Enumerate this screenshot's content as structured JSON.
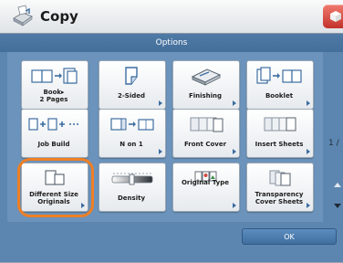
{
  "app": {
    "title": "Copy",
    "icon": "copy-machine-icon"
  },
  "panel": {
    "title": "Options"
  },
  "tiles": [
    {
      "label": "Book▸\n2 Pages",
      "icon": "book-to-two-pages-icon"
    },
    {
      "label": "2-Sided",
      "icon": "two-sided-icon"
    },
    {
      "label": "Finishing",
      "icon": "finishing-icon"
    },
    {
      "label": "Booklet",
      "icon": "booklet-icon"
    },
    {
      "label": "Job Build",
      "icon": "job-build-icon"
    },
    {
      "label": "N on 1",
      "icon": "n-on-one-icon"
    },
    {
      "label": "Front Cover",
      "icon": "front-cover-icon"
    },
    {
      "label": "Insert Sheets",
      "icon": "insert-sheets-icon"
    },
    {
      "label": "Different Size\nOriginals",
      "icon": "different-size-originals-icon"
    },
    {
      "label": "Density",
      "icon": "density-icon"
    },
    {
      "label": "Original Type",
      "icon": "original-type-icon"
    },
    {
      "label": "Transparency\nCover Sheets",
      "icon": "transparency-cover-icon"
    }
  ],
  "pager": {
    "text": "1 /"
  },
  "ok_button": {
    "label": "OK"
  },
  "colors": {
    "accent_ring": "#ee7f24",
    "panel_bg": "#5c86b0",
    "arrow": "#3c6da1"
  }
}
